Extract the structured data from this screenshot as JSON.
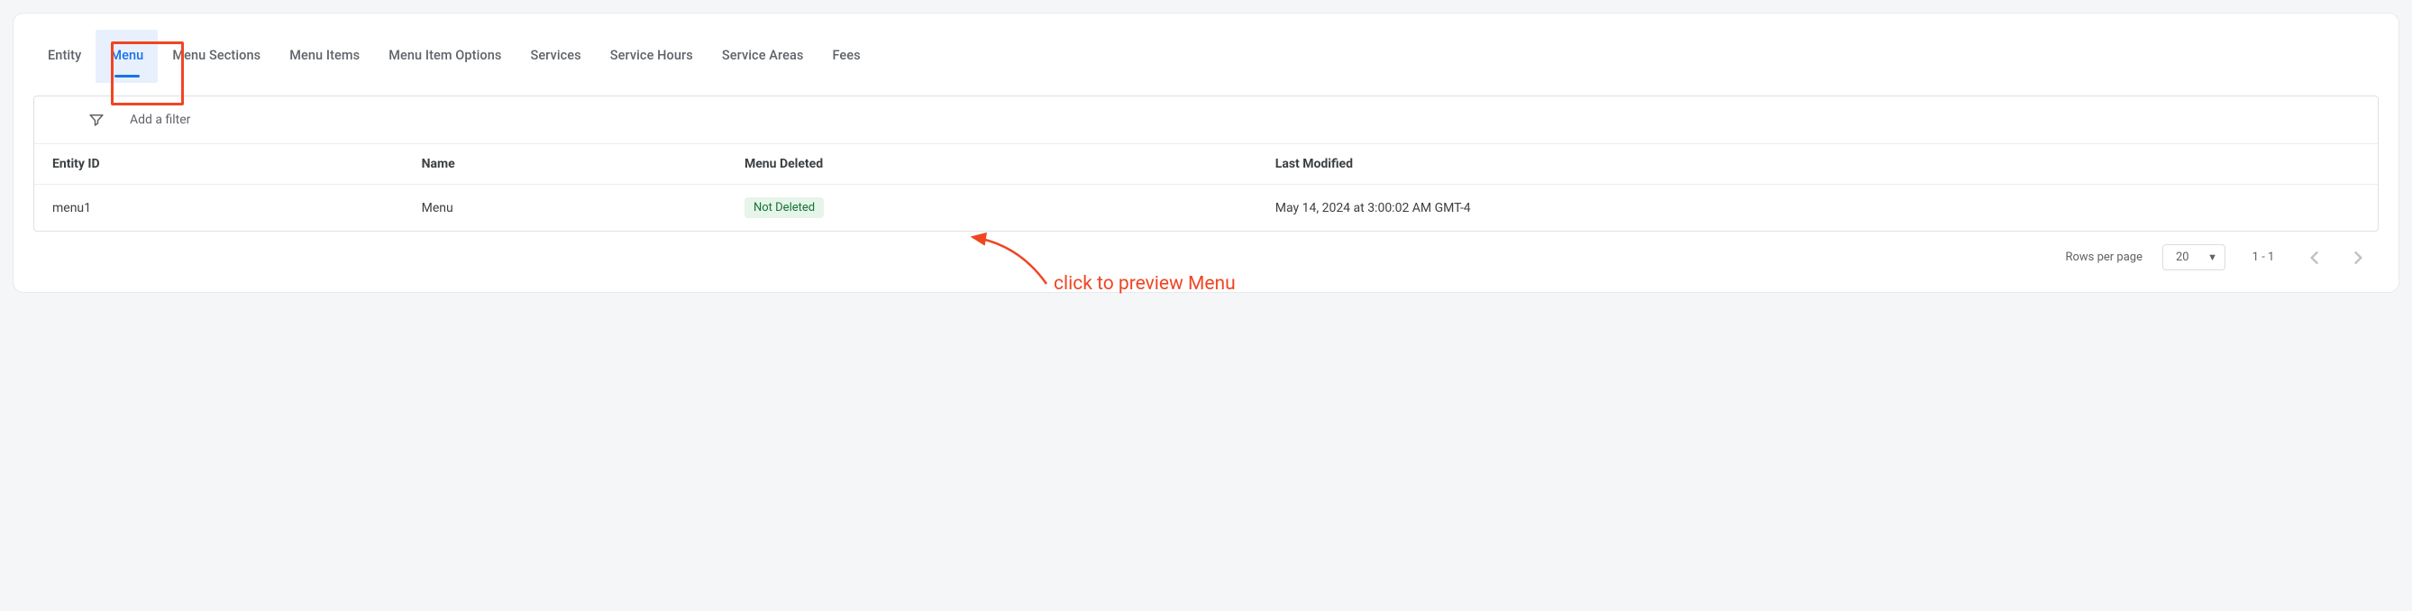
{
  "tabs": [
    {
      "label": "Entity",
      "active": false
    },
    {
      "label": "Menu",
      "active": true
    },
    {
      "label": "Menu Sections",
      "active": false
    },
    {
      "label": "Menu Items",
      "active": false
    },
    {
      "label": "Menu Item Options",
      "active": false
    },
    {
      "label": "Services",
      "active": false
    },
    {
      "label": "Service Hours",
      "active": false
    },
    {
      "label": "Service Areas",
      "active": false
    },
    {
      "label": "Fees",
      "active": false
    }
  ],
  "filter": {
    "placeholder": "Add a filter"
  },
  "table": {
    "headers": {
      "entity_id": "Entity ID",
      "name": "Name",
      "menu_deleted": "Menu Deleted",
      "last_modified": "Last Modified"
    },
    "rows": [
      {
        "entity_id": "menu1",
        "name": "Menu",
        "menu_deleted": "Not Deleted",
        "last_modified": "May 14, 2024 at 3:00:02 AM GMT-4"
      }
    ]
  },
  "pagination": {
    "rows_per_page_label": "Rows per page",
    "rows_per_page_value": "20",
    "range": "1 - 1"
  },
  "annotation": {
    "text": "click to preview Menu"
  },
  "colors": {
    "accent": "#1a73e8",
    "annotation": "#f04522",
    "badge_bg": "#e6f4ea",
    "badge_fg": "#137333"
  }
}
